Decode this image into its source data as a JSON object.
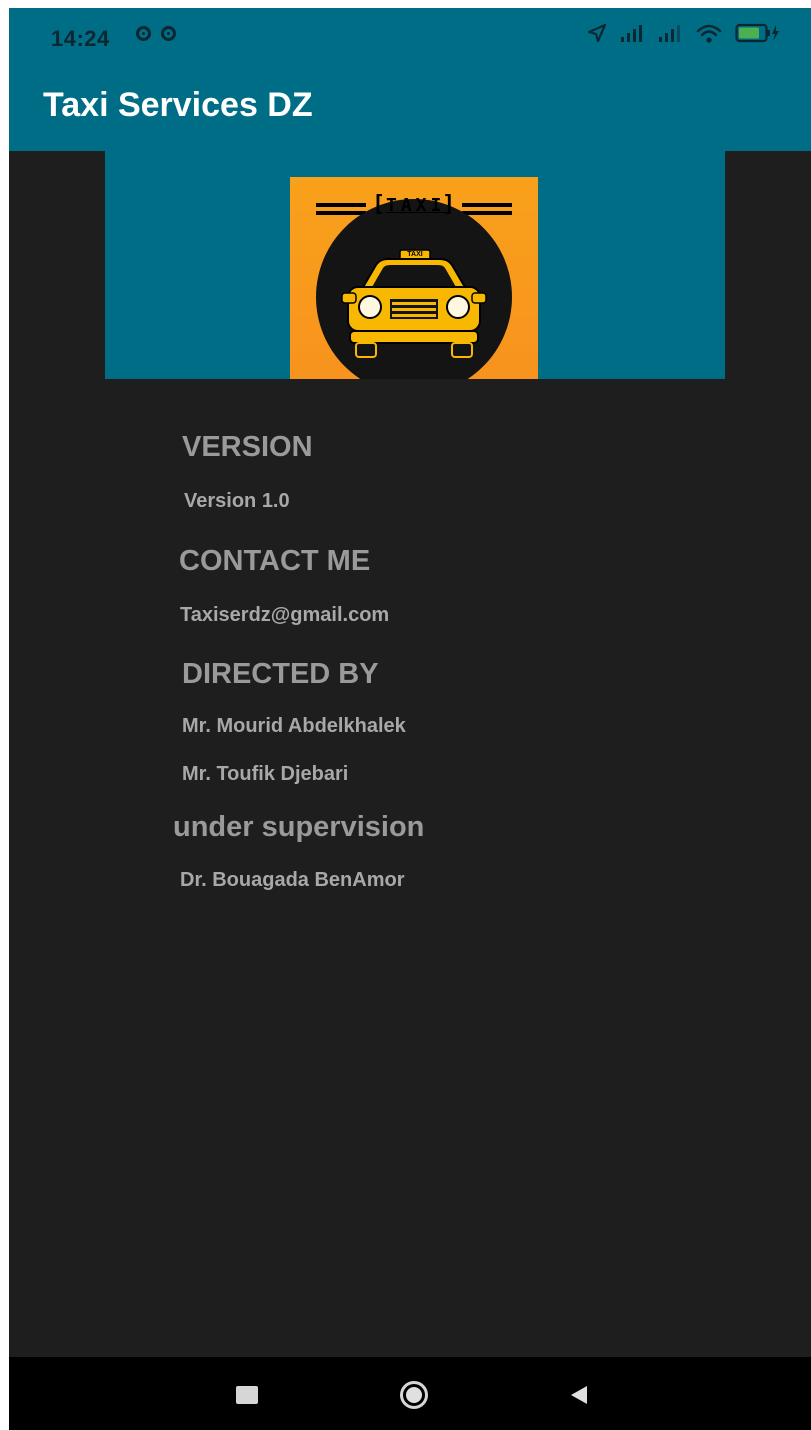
{
  "status_bar": {
    "time": "14:24",
    "left_icons": [
      "notification-circle-icon",
      "notification-circle-icon"
    ],
    "right_icons": [
      "location-arrow-icon",
      "signal-icon",
      "signal-icon",
      "wifi-icon",
      "battery-charging-icon"
    ],
    "battery_color": "#4caf50"
  },
  "app_bar": {
    "title": "Taxi Services DZ",
    "color": "#006d87"
  },
  "logo": {
    "sign_text": "TAXI",
    "car_sign_text": "TAXI",
    "colors": {
      "background": "#f7931e",
      "car": "#f9b800",
      "circle": "#111111"
    }
  },
  "about": {
    "version_heading": "VERSION",
    "version_value": "Version 1.0",
    "contact_heading": "CONTACT ME",
    "contact_email": "Taxiserdz@gmail.com",
    "directed_heading": "DIRECTED BY",
    "director_1": "Mr. Mourid Abdelkhalek",
    "director_2": "Mr. Toufik Djebari",
    "supervision_heading": "under supervision",
    "supervisor": "Dr. Bouagada BenAmor"
  },
  "nav_bar": {
    "buttons": [
      "recents-square-icon",
      "home-circle-icon",
      "back-triangle-icon"
    ]
  }
}
